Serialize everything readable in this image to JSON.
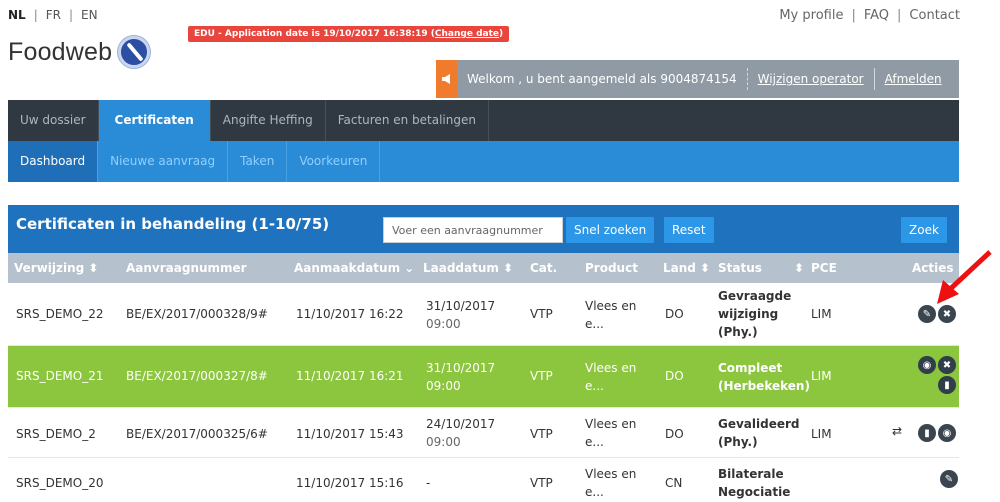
{
  "lang": {
    "nl": "NL",
    "fr": "FR",
    "en": "EN",
    "sep": "|"
  },
  "top_links": {
    "profile": "My profile",
    "faq": "FAQ",
    "contact": "Contact",
    "sep": "|"
  },
  "edu_banner": {
    "text": "EDU - Application date is 19/10/2017 16:38:19 (",
    "link": "Change date",
    "close": ")"
  },
  "logo": {
    "text": "Foodweb"
  },
  "welcome": {
    "text": "Welkom , u bent aangemeld als 9004874154",
    "change_operator": "Wijzigen operator",
    "logout": "Afmelden"
  },
  "main_nav": {
    "dossier": "Uw dossier",
    "certificaten": "Certificaten",
    "angifte": "Angifte Heffing",
    "facturen": "Facturen en betalingen"
  },
  "sub_nav": {
    "dashboard": "Dashboard",
    "nieuwe": "Nieuwe aanvraag",
    "taken": "Taken",
    "voorkeuren": "Voorkeuren"
  },
  "panel": {
    "title": "Certificaten in behandeling (1-10/75)",
    "search_placeholder": "Voer een aanvraagnummer",
    "snel_zoeken": "Snel zoeken",
    "reset": "Reset",
    "zoek": "Zoek"
  },
  "table": {
    "headers": {
      "verwijzing": "Verwijzing ⬍",
      "aanvraagnummer": "Aanvraagnummer",
      "aanmaakdatum": "Aanmaakdatum ⌄",
      "laaddatum": "Laaddatum ⬍",
      "cat": "Cat.",
      "product": "Product",
      "land": "Land ⬍",
      "status": "Status",
      "status_sort": "⬍",
      "pce": "PCE",
      "acties": "Acties"
    },
    "rows": [
      {
        "verwijzing": "SRS_DEMO_22",
        "aanvraag": "BE/EX/2017/000328/9#",
        "aanmaak": "11/10/2017 16:22",
        "laad1": "31/10/2017",
        "laad2": "09:00",
        "cat": "VTP",
        "product1": "Vlees en",
        "product2": "e...",
        "land": "DO",
        "status1": "Gevraagde",
        "status2": "wijziging",
        "status3": "(Phy.)",
        "pce": "LIM"
      },
      {
        "verwijzing": "SRS_DEMO_21",
        "aanvraag": "BE/EX/2017/000327/8#",
        "aanmaak": "11/10/2017 16:21",
        "laad1": "31/10/2017",
        "laad2": "09:00",
        "cat": "VTP",
        "product1": "Vlees en",
        "product2": "e...",
        "land": "DO",
        "status1": "Compleet",
        "status2": "(Herbekeken)",
        "pce": "LIM"
      },
      {
        "verwijzing": "SRS_DEMO_2",
        "aanvraag": "BE/EX/2017/000325/6#",
        "aanmaak": "11/10/2017 15:43",
        "laad1": "24/10/2017",
        "laad2": "09:00",
        "cat": "VTP",
        "product1": "Vlees en",
        "product2": "e...",
        "land": "DO",
        "status1": "Gevalideerd",
        "status2": "(Phy.)",
        "pce": "LIM"
      },
      {
        "verwijzing": "SRS_DEMO_20",
        "aanvraag": "",
        "aanmaak": "11/10/2017 15:16",
        "laad1": "-",
        "cat": "VTP",
        "product1": "Vlees en",
        "product2": "e...",
        "land": "CN",
        "status1": "Bilaterale",
        "status2": "Negociatie"
      }
    ]
  },
  "colors": {
    "nav_dark": "#303841",
    "blue": "#2a8bd6",
    "panel_blue": "#1f72bd",
    "green_row": "#8cc63e",
    "alert_red": "#e8453c",
    "annotation_arrow": "#e11"
  },
  "icons": {
    "edit": "edit-icon",
    "delete": "close-icon",
    "view": "eye-icon",
    "document": "document-icon",
    "transfer": "swap-icon",
    "megaphone": "megaphone-icon"
  }
}
